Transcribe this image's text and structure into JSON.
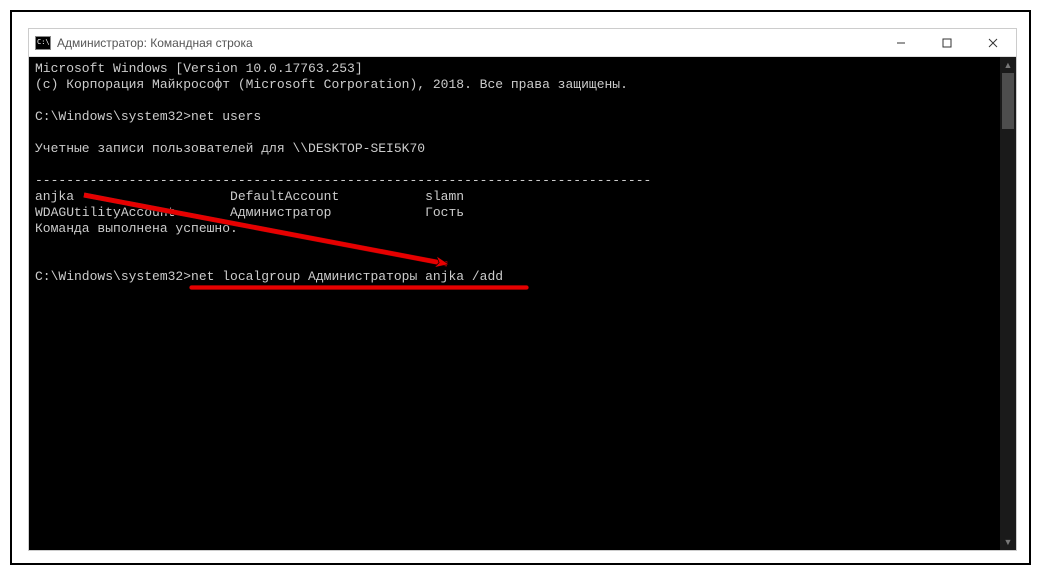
{
  "window": {
    "title": "Администратор: Командная строка"
  },
  "terminal": {
    "line1": "Microsoft Windows [Version 10.0.17763.253]",
    "line2": "(c) Корпорация Майкрософт (Microsoft Corporation), 2018. Все права защищены.",
    "blank1": "",
    "prompt1": "C:\\Windows\\system32>net users",
    "blank2": "",
    "line3": "Учетные записи пользователей для \\\\DESKTOP-SEI5K70",
    "blank3": "",
    "divider": "-------------------------------------------------------------------------------",
    "row1": "anjka                    DefaultAccount           slamn",
    "row2": "WDAGUtilityAccount       Администратор            Гость",
    "line4": "Команда выполнена успешно.",
    "blank4": "",
    "blank5": "",
    "prompt2": "C:\\Windows\\system32>net localgroup Администраторы anjka /add"
  },
  "annotations": {
    "arrow_color": "#e60000",
    "underline_color": "#e60000"
  }
}
